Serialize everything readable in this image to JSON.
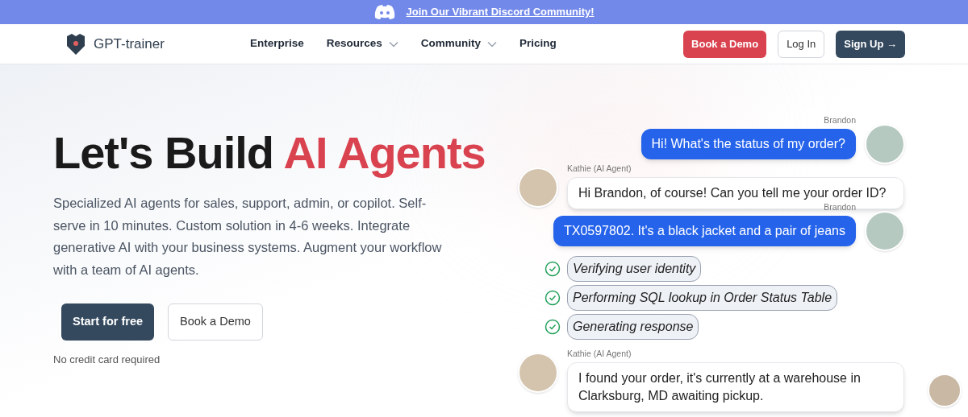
{
  "banner": {
    "link": "Join Our Vibrant Discord Community!"
  },
  "nav": {
    "brand": "GPT-trainer",
    "links": [
      {
        "label": "Enterprise",
        "dropdown": false
      },
      {
        "label": "Resources",
        "dropdown": true
      },
      {
        "label": "Community",
        "dropdown": true
      },
      {
        "label": "Pricing",
        "dropdown": false
      }
    ],
    "buttons": [
      {
        "label": "Book a Demo",
        "kind": "accent"
      },
      {
        "label": "Log In",
        "kind": "outline"
      },
      {
        "label": "Sign Up →",
        "kind": "dark"
      }
    ]
  },
  "hero": {
    "title": "Let's Build",
    "title_highlight": "AI Agents",
    "text": "Specialized AI agents for sales, support, admin, or copilot. Self-serve in 10 minutes. Custom solution in 4-6 weeks. Integrate generative AI with your business systems. Augment your workflow with a team of AI agents.",
    "buttons": [
      {
        "label": "Start for free",
        "kind": "dark"
      },
      {
        "label": "Book a Demo",
        "kind": "outline"
      }
    ],
    "note": "No credit card required"
  },
  "chat": [
    {
      "kind": "user",
      "sender": "Brandon",
      "text": "Hi! What's the status of my order?"
    },
    {
      "kind": "agent",
      "sender": "Kathie (AI Agent)",
      "text": "Hi Brandon, of course! Can you tell me your order ID?"
    },
    {
      "kind": "user",
      "sender": "Brandon",
      "text": "TX0597802. It's a black jacket and a pair of jeans"
    },
    {
      "kind": "steps",
      "steps": [
        {
          "text": "Verifying user identity",
          "checked": true
        },
        {
          "text": "Performing SQL lookup in Order Status Table",
          "checked": true
        },
        {
          "text": "Generating response",
          "checked": true
        }
      ]
    },
    {
      "kind": "agent",
      "sender": "Kathie (AI Agent)",
      "text": "I found your order, it's currently at a warehouse in Clarksburg, MD awaiting pickup."
    }
  ]
}
